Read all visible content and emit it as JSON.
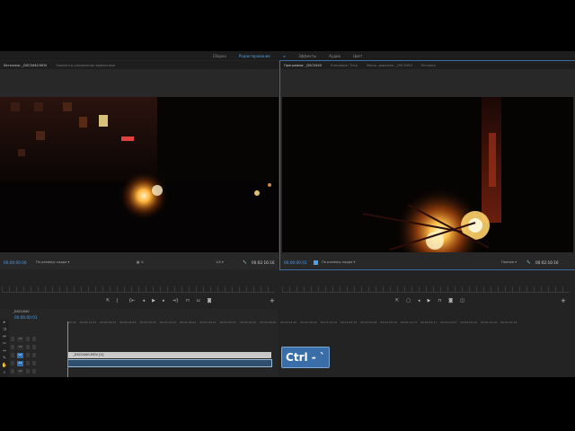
{
  "workspace_tabs": [
    "Сборка",
    "Редактирование",
    "Эффекты",
    "Аудио",
    "Цвет"
  ],
  "workspace_active": 1,
  "source": {
    "tabs": [
      "Источник: _DSC0440.MOV",
      "Элементы управления эффектами"
    ],
    "timecode_left": "00:00:00:00",
    "fit_label": "По размеру кадра",
    "resolution": "1/4",
    "timecode_right": "00:02:16:16"
  },
  "program": {
    "tabs": [
      "Программа: _DSC0440",
      "Ключевое: Титр",
      "Микш. дорожек: _DSC0440",
      "История"
    ],
    "timecode_left": "00:00:00:01",
    "fit_label": "По размеру кадра",
    "resolution": "Полное",
    "timecode_right": "00:02:16:16"
  },
  "timeline": {
    "sequence_name": "_DSC0440",
    "timecode": "00:00:00:01",
    "ruler": [
      "00:00",
      "00:00:14:23",
      "00:00:29:23",
      "00:00:44:22",
      "00:00:59:22",
      "00:01:14:22",
      "00:01:29:21",
      "00:01:44:21",
      "00:01:59:21",
      "00:02:14:20",
      "00:02:29:20",
      "00:02:44:20",
      "00:02:59:19",
      "00:03:14:19",
      "00:03:29:19",
      "00:03:44:18",
      "00:03:59:18",
      "00:04:14:17",
      "00:04:29:17",
      "00:04:44:17",
      "00:04:59:16",
      "00:05:14:16",
      "00:05:29:16"
    ],
    "tracks": [
      "V3",
      "V2",
      "V1",
      "A1",
      "A2"
    ],
    "video_clip": "_DSC0440.MOV [V]"
  },
  "keyboard_hint": "Ctrl - `"
}
